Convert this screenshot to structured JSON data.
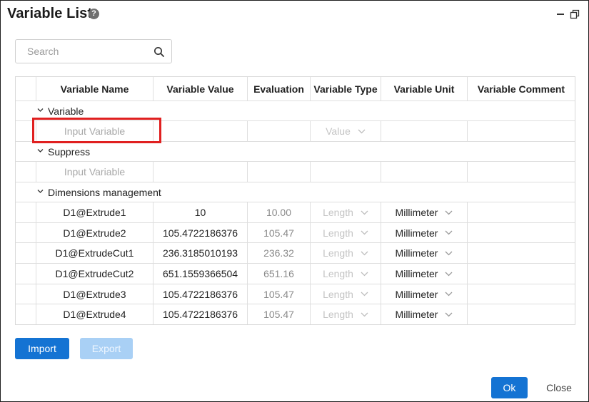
{
  "window": {
    "title": "Variable List"
  },
  "search": {
    "placeholder": "Search",
    "value": ""
  },
  "table": {
    "columns": [
      "Variable Name",
      "Variable Value",
      "Evaluation",
      "Variable Type",
      "Variable Unit",
      "Variable Comment"
    ],
    "groups": [
      {
        "label": "Variable",
        "input_placeholder": "Input Variable",
        "type_placeholder": "Value"
      },
      {
        "label": "Suppress",
        "input_placeholder": "Input Variable"
      },
      {
        "label": "Dimensions management"
      }
    ],
    "rows": [
      {
        "name": "D1@Extrude1",
        "value": "10",
        "evaluation": "10.00",
        "type": "Length",
        "unit": "Millimeter",
        "comment": ""
      },
      {
        "name": "D1@Extrude2",
        "value": "105.4722186376",
        "evaluation": "105.47",
        "type": "Length",
        "unit": "Millimeter",
        "comment": ""
      },
      {
        "name": "D1@ExtrudeCut1",
        "value": "236.3185010193",
        "evaluation": "236.32",
        "type": "Length",
        "unit": "Millimeter",
        "comment": ""
      },
      {
        "name": "D1@ExtrudeCut2",
        "value": "651.1559366504",
        "evaluation": "651.16",
        "type": "Length",
        "unit": "Millimeter",
        "comment": ""
      },
      {
        "name": "D1@Extrude3",
        "value": "105.4722186376",
        "evaluation": "105.47",
        "type": "Length",
        "unit": "Millimeter",
        "comment": ""
      },
      {
        "name": "D1@Extrude4",
        "value": "105.4722186376",
        "evaluation": "105.47",
        "type": "Length",
        "unit": "Millimeter",
        "comment": ""
      }
    ]
  },
  "buttons": {
    "import": "Import",
    "export": "Export",
    "ok": "Ok",
    "close": "Close"
  },
  "colors": {
    "primary": "#1473d3",
    "primary_disabled": "#a9d0f5",
    "highlight": "#e02020"
  },
  "icons": {
    "help": "help-icon",
    "minimize": "minimize-icon",
    "restore": "restore-icon",
    "search": "search-icon",
    "chevron": "chevron-down-icon"
  }
}
